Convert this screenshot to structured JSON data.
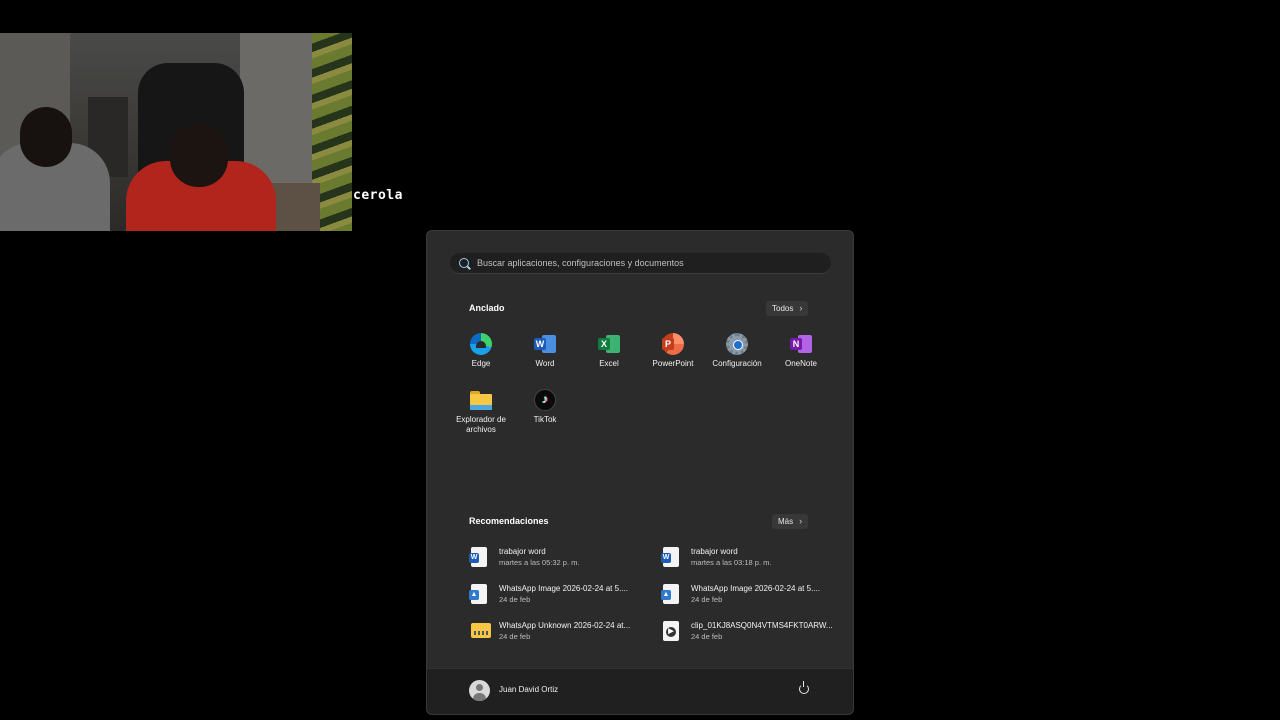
{
  "webcam": {
    "label": "cerola"
  },
  "start_menu": {
    "search": {
      "placeholder": "Buscar aplicaciones, configuraciones y documentos"
    },
    "pinned": {
      "title": "Anclado",
      "all_button": "Todos",
      "apps": [
        {
          "label": "Edge",
          "icon": "edge-icon"
        },
        {
          "label": "Word",
          "icon": "word-icon"
        },
        {
          "label": "Excel",
          "icon": "excel-icon"
        },
        {
          "label": "PowerPoint",
          "icon": "powerpoint-icon"
        },
        {
          "label": "Configuración",
          "icon": "gear-icon"
        },
        {
          "label": "OneNote",
          "icon": "onenote-icon"
        },
        {
          "label": "Explorador de archivos",
          "icon": "folder-icon"
        },
        {
          "label": "TikTok",
          "icon": "tiktok-icon"
        }
      ]
    },
    "recommended": {
      "title": "Recomendaciones",
      "more_button": "Más",
      "items": [
        {
          "name": "trabajor word",
          "date": "martes a las 05:32 p. m.",
          "icon": "word-document-icon"
        },
        {
          "name": "trabajor word",
          "date": "martes a las 03:18 p. m.",
          "icon": "word-document-icon"
        },
        {
          "name": "WhatsApp Image 2026-02-24 at 5....",
          "date": "24 de feb",
          "icon": "image-file-icon"
        },
        {
          "name": "WhatsApp Image 2026-02-24 at 5....",
          "date": "24 de feb",
          "icon": "image-file-icon"
        },
        {
          "name": "WhatsApp Unknown 2026-02-24 at...",
          "date": "24 de feb",
          "icon": "zip-folder-icon"
        },
        {
          "name": "clip_01KJ8ASQ0N4VTMS4FKT0ARW...",
          "date": "24 de feb",
          "icon": "video-file-icon"
        }
      ]
    },
    "user": {
      "name": "Juan David Ortiz"
    },
    "colors": {
      "panel": "#2b2b2b",
      "footer": "#202020",
      "accent": "#9ad0f0"
    }
  }
}
